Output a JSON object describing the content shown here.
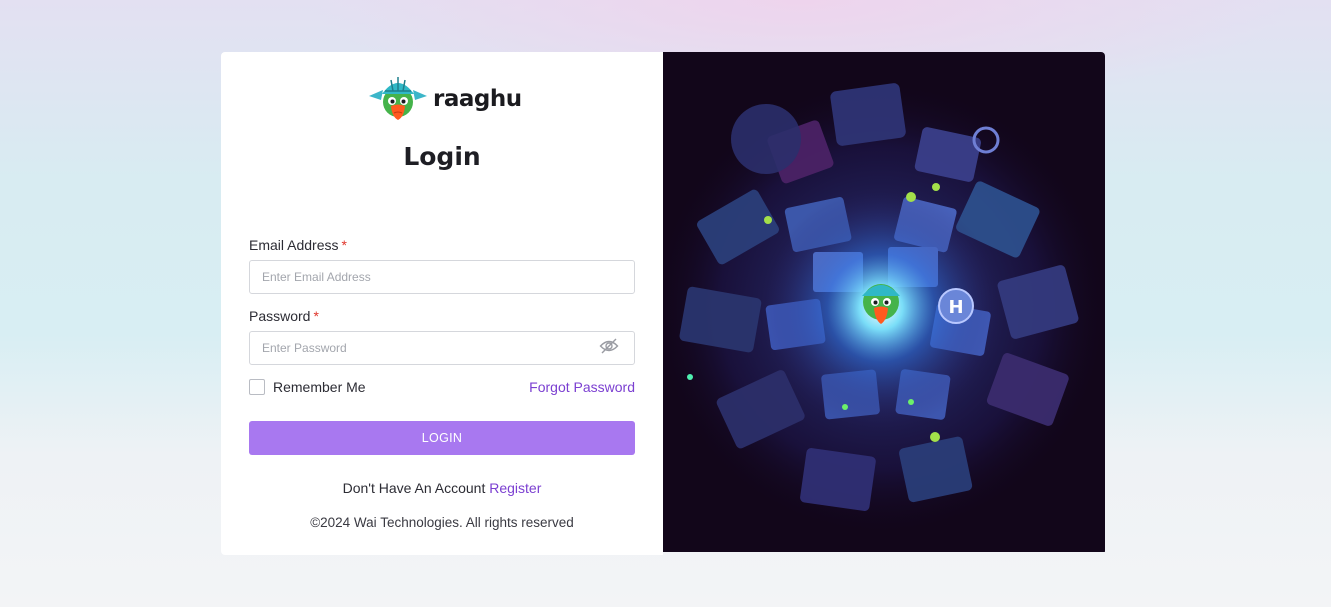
{
  "brand": {
    "name": "raaghu"
  },
  "login": {
    "title": "Login",
    "email_label": "Email Address",
    "email_placeholder": "Enter Email Address",
    "password_label": "Password",
    "password_placeholder": "Enter Password",
    "required_marker": "*",
    "remember_label": "Remember Me",
    "forgot_label": "Forgot Password",
    "submit_label": "LOGIN",
    "no_account_text": "Don't Have An Account",
    "register_label": "Register",
    "copyright": "©2024 Wai Technologies. All rights reserved"
  },
  "icons": {
    "logo": "parrot-mascot-icon",
    "password_toggle": "eye-slash-icon",
    "hero": "isometric-city-parrot-illustration"
  },
  "colors": {
    "accent": "#7b3fd1",
    "button": "#a878f0",
    "required": "#e0342a",
    "hero_bg": "#12061a"
  }
}
